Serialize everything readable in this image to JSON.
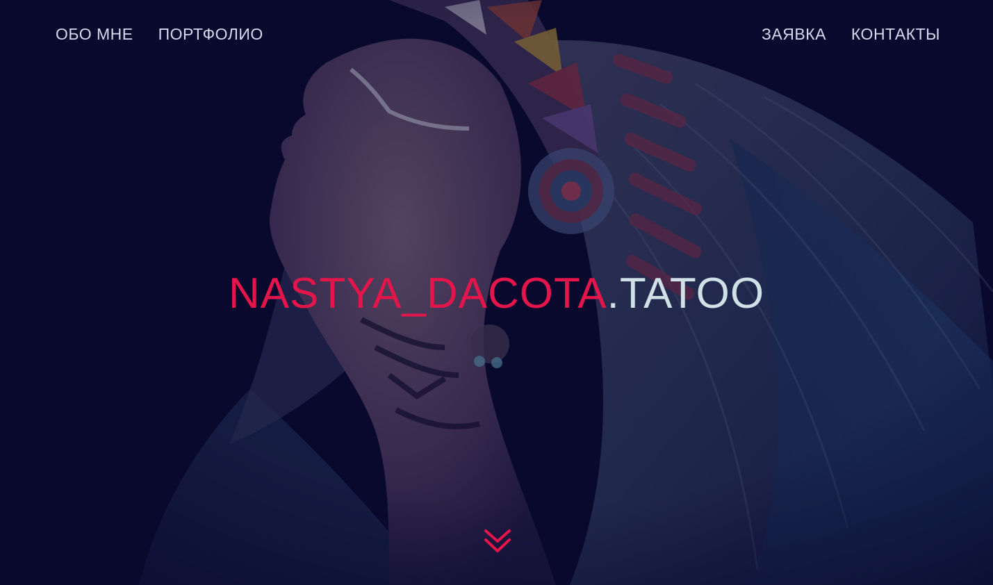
{
  "nav": {
    "left": [
      {
        "label": "ОБО МНЕ"
      },
      {
        "label": "ПОРТФОЛИО"
      }
    ],
    "right": [
      {
        "label": "ЗАЯВКА"
      },
      {
        "label": "КОНТАКТЫ"
      }
    ]
  },
  "hero": {
    "brand_name": "NASTYA_DACOTA",
    "brand_domain": ".TATOO",
    "image": "photo-woman-in-feather-headdress",
    "scroll_icon": "double-chevron-down-icon"
  },
  "colors": {
    "background": "#0c0b30",
    "accent": "#e3154a",
    "nav_text": "#d6d9ec",
    "brand_domain": "#cfe0e6"
  }
}
